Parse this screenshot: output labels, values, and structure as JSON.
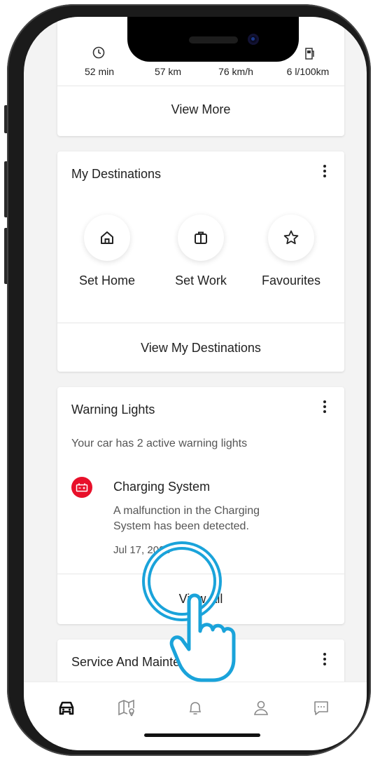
{
  "trip_stats": {
    "items": [
      {
        "value": "52 min",
        "icon": "clock-icon"
      },
      {
        "value": "57 km"
      },
      {
        "value": "76 km/h"
      },
      {
        "value": "6 l/100km",
        "icon": "fuel-icon"
      }
    ],
    "view_more_label": "View More"
  },
  "destinations": {
    "title": "My Destinations",
    "items": [
      {
        "label": "Set Home",
        "icon": "home-icon"
      },
      {
        "label": "Set Work",
        "icon": "briefcase-icon"
      },
      {
        "label": "Favourites",
        "icon": "star-icon"
      }
    ],
    "view_label": "View My Destinations"
  },
  "warnings": {
    "title": "Warning Lights",
    "summary": "Your car has 2 active warning lights",
    "item": {
      "title": "Charging System",
      "description_line1": "A malfunction in the Charging",
      "description_line2": "System has been detected.",
      "date": "Jul 17, 2023",
      "icon": "battery-icon",
      "color": "#e8102a"
    },
    "view_all_label": "View All"
  },
  "service": {
    "title": "Service And Maintenance"
  },
  "tabbar": {
    "tabs": [
      {
        "name": "car-icon",
        "active": true
      },
      {
        "name": "map-icon"
      },
      {
        "name": "bell-icon"
      },
      {
        "name": "profile-icon"
      },
      {
        "name": "chat-icon"
      }
    ]
  },
  "colors": {
    "accent_touch": "#1aa3da",
    "warning": "#e8102a"
  }
}
